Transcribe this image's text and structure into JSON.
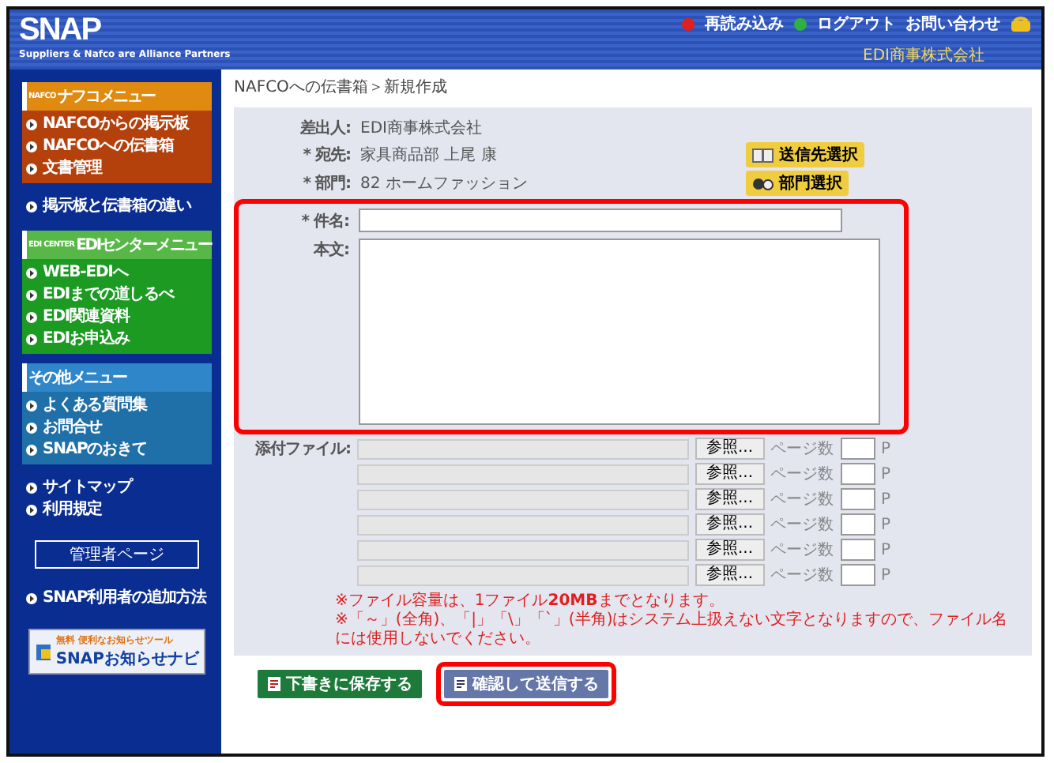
{
  "header": {
    "logo": "SNAP",
    "tagline": "Suppliers & Nafco are Alliance Partners",
    "links": [
      {
        "kind": "reload",
        "label": "再読み込み"
      },
      {
        "kind": "logout",
        "label": "ログアウト"
      },
      {
        "kind": "contact",
        "label": "お問い合わせ"
      }
    ],
    "company": "EDI商事株式会社"
  },
  "sidebar": [
    {
      "kind": "nafco",
      "badge": "NAFCO",
      "title": "ナフコメニュー",
      "items": [
        "NAFCOからの掲示板",
        "NAFCOへの伝書箱",
        "文書管理"
      ]
    },
    {
      "kind": "links",
      "items": [
        "掲示板と伝書箱の違い"
      ]
    },
    {
      "kind": "edi",
      "badge": "EDI CENTER",
      "title": "EDIセンターメニュー",
      "items": [
        "WEB-EDIへ",
        "EDIまでの道しるべ",
        "EDI関連資料",
        "EDIお申込み"
      ]
    },
    {
      "kind": "other",
      "title": "その他メニュー",
      "items": [
        "よくある質問集",
        "お問合せ",
        "SNAPのおきて"
      ]
    },
    {
      "kind": "links",
      "items": [
        "サイトマップ",
        "利用規定"
      ]
    },
    {
      "kind": "admin",
      "label": "管理者ページ"
    },
    {
      "kind": "links",
      "items": [
        "SNAP利用者の追加方法"
      ]
    },
    {
      "kind": "banner",
      "tag": "無料",
      "caption": "便利なお知らせツール",
      "title": "SNAPお知らせナビ"
    }
  ],
  "breadcrumb": "NAFCOへの伝書箱＞新規作成",
  "form": {
    "sender": {
      "label": "差出人:",
      "value": "EDI商事株式会社"
    },
    "to": {
      "label": "宛先:",
      "value": "家具商品部 上尾 康",
      "button": "送信先選択"
    },
    "dept": {
      "label": "部門:",
      "value": "82 ホームファッション",
      "button": "部門選択"
    },
    "required_mark": "*",
    "subject": {
      "label": "件名:"
    },
    "body": {
      "label": "本文:"
    },
    "attach": {
      "label": "添付ファイル:",
      "rows": [
        {
          "button": "参照...",
          "pages_label": "ページ数",
          "unit": "P"
        },
        {
          "button": "参照...",
          "pages_label": "ページ数",
          "unit": "P"
        },
        {
          "button": "参照...",
          "pages_label": "ページ数",
          "unit": "P"
        },
        {
          "button": "参照...",
          "pages_label": "ページ数",
          "unit": "P"
        },
        {
          "button": "参照...",
          "pages_label": "ページ数",
          "unit": "P"
        },
        {
          "button": "参照...",
          "pages_label": "ページ数",
          "unit": "P"
        }
      ]
    },
    "notes": [
      "※ファイル容量は、1ファイル**20MB**までとなります。",
      "※「～」(全角)、「|」「\\」「`」(半角)はシステム上扱えない文字となりますので、ファイル名には使用しないでください。"
    ]
  },
  "actions": [
    {
      "kind": "draft",
      "label": "下書きに保存する",
      "highlighted": false
    },
    {
      "kind": "send",
      "label": "確認して送信する",
      "highlighted": true
    }
  ]
}
